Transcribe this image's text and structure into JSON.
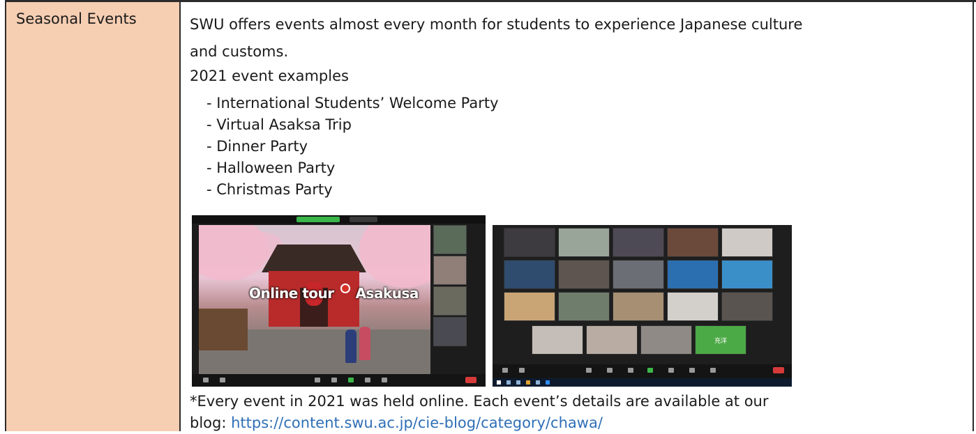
{
  "row": {
    "label": "Seasonal Events",
    "intro": "SWU offers events almost every month for students to experience Japanese culture and customs.",
    "intro_line1": "SWU offers events almost every month for students to experience Japanese culture",
    "intro_line2": "and customs.",
    "examples_title": "2021 event examples",
    "events": [
      "International Students’ Welcome Party",
      "Virtual Asaksa Trip",
      "Dinner Party",
      "Halloween Party",
      "Christmas Party"
    ],
    "photo1": {
      "caption": "Online tour",
      "place": "Asakusa"
    },
    "photo2": {
      "tile_text": "充洋"
    },
    "footnote_line1": "*Every event in 2021 was held online. Each event’s details are available at our",
    "footnote_prefix": "blog: ",
    "footnote_link": "https://content.swu.ac.jp/cie-blog/category/chawa/"
  },
  "colors": {
    "label_bg": "#f6ceb2",
    "link": "#2f6fb7",
    "border": "#2b2b2b"
  }
}
